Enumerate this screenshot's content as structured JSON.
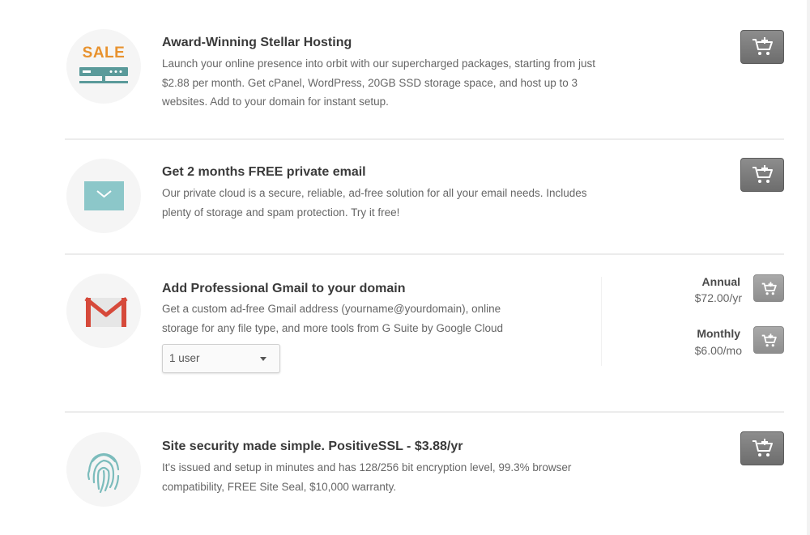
{
  "products": [
    {
      "id": "hosting",
      "icon": "sale-server-icon",
      "icon_text": "SALE",
      "title": "Award-Winning Stellar Hosting",
      "description_lines": [
        "Launch your online presence into orbit with our supercharged packages, starting from just",
        "$2.88 per month. Get cPanel, WordPress, 20GB SSD storage space, and host up to 3",
        "websites. Add to your domain for instant setup."
      ]
    },
    {
      "id": "email",
      "icon": "envelope-icon",
      "title": "Get 2 months FREE private email",
      "description_lines": [
        "Our private cloud is a secure, reliable, ad-free solution for all your email needs. Includes",
        "plenty of storage and spam protection. Try it free!"
      ]
    },
    {
      "id": "gmail",
      "icon": "gmail-icon",
      "title": "Add Professional Gmail to your domain",
      "description_lines": [
        "Get a custom ad-free Gmail address (yourname@yourdomain), online",
        "storage for any file type, and more tools from G Suite by Google Cloud"
      ],
      "user_select": {
        "selected": "1 user"
      },
      "pricing": [
        {
          "label": "Annual",
          "price": "$72.00/yr"
        },
        {
          "label": "Monthly",
          "price": "$6.00/mo"
        }
      ]
    },
    {
      "id": "ssl",
      "icon": "fingerprint-icon",
      "title": "Site security made simple. PositiveSSL - $3.88/yr",
      "description_lines": [
        "It's issued and setup in minutes and has 128/256 bit encryption level, 99.3% browser",
        "compatibility, FREE Site Seal, $10,000 warranty."
      ]
    }
  ],
  "colors": {
    "sale_orange": "#e8922e",
    "server_teal": "#5a9a9a",
    "envelope_teal": "#8cc7c9",
    "gmail_red": "#d6493a",
    "fingerprint_teal": "#7cbcbc",
    "cart_button": "#7a7a7a"
  }
}
